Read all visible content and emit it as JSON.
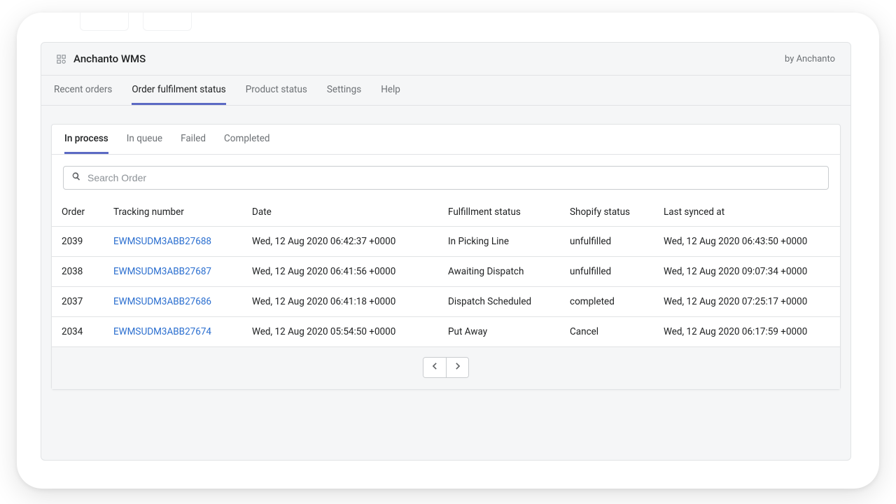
{
  "header": {
    "title": "Anchanto WMS",
    "byline": "by Anchanto"
  },
  "main_tabs": [
    {
      "label": "Recent orders",
      "active": false
    },
    {
      "label": "Order fulfilment status",
      "active": true
    },
    {
      "label": "Product status",
      "active": false
    },
    {
      "label": "Settings",
      "active": false
    },
    {
      "label": "Help",
      "active": false
    }
  ],
  "sub_tabs": [
    {
      "label": "In process",
      "active": true
    },
    {
      "label": "In queue",
      "active": false
    },
    {
      "label": "Failed",
      "active": false
    },
    {
      "label": "Completed",
      "active": false
    }
  ],
  "search": {
    "placeholder": "Search Order",
    "value": ""
  },
  "columns": {
    "order": "Order",
    "tracking": "Tracking number",
    "date": "Date",
    "fulfillment": "Fulfillment status",
    "shopify": "Shopify status",
    "synced": "Last synced at"
  },
  "rows": [
    {
      "order": "2039",
      "tracking": "EWMSUDM3ABB27688",
      "date": "Wed, 12 Aug 2020 06:42:37 +0000",
      "fulfillment": "In Picking Line",
      "shopify": "unfulfilled",
      "synced": "Wed, 12 Aug 2020 06:43:50 +0000"
    },
    {
      "order": "2038",
      "tracking": "EWMSUDM3ABB27687",
      "date": "Wed, 12 Aug 2020 06:41:56 +0000",
      "fulfillment": "Awaiting Dispatch",
      "shopify": "unfulfilled",
      "synced": "Wed, 12 Aug 2020 09:07:34 +0000"
    },
    {
      "order": "2037",
      "tracking": "EWMSUDM3ABB27686",
      "date": "Wed, 12 Aug 2020 06:41:18 +0000",
      "fulfillment": "Dispatch Scheduled",
      "shopify": "completed",
      "synced": "Wed, 12 Aug 2020 07:25:17 +0000"
    },
    {
      "order": "2034",
      "tracking": "EWMSUDM3ABB27674",
      "date": "Wed, 12 Aug 2020 05:54:50 +0000",
      "fulfillment": "Put Away",
      "shopify": "Cancel",
      "synced": "Wed, 12 Aug 2020 06:17:59 +0000"
    }
  ]
}
